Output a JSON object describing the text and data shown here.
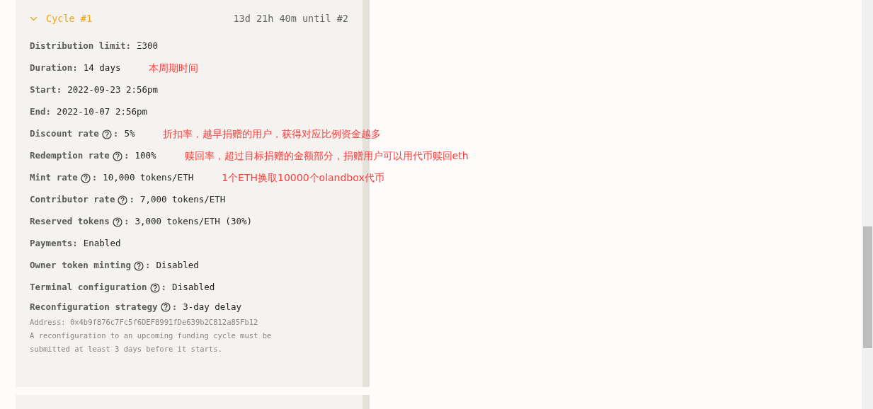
{
  "separator": ":",
  "cycle": {
    "title": "Cycle #1",
    "expanded": true,
    "countdown": "13d 21h 40m until #2"
  },
  "details": [
    {
      "label": "Distribution limit",
      "help": false,
      "value": "Ξ300"
    },
    {
      "label": "Duration",
      "help": false,
      "value": "14 days",
      "annotation": "本周期时间"
    },
    {
      "label": "Start",
      "help": false,
      "value": "2022-09-23 2:56pm"
    },
    {
      "label": "End",
      "help": false,
      "value": "2022-10-07 2:56pm"
    },
    {
      "label": "Discount rate",
      "help": true,
      "value": "5%",
      "annotation": "折扣率，越早捐赠的用户，获得对应比例资金越多"
    },
    {
      "label": "Redemption rate",
      "help": true,
      "value": "100%",
      "annotation": "赎回率，超过目标捐赠的金额部分，捐赠用户可以用代币赎回eth"
    },
    {
      "label": "Mint rate",
      "help": true,
      "value": "10,000 tokens/ETH",
      "annotation": "1个ETH换取10000个olandbox代币"
    },
    {
      "label": "Contributor rate",
      "help": true,
      "value": "7,000 tokens/ETH"
    },
    {
      "label": "Reserved tokens",
      "help": true,
      "value": "3,000 tokens/ETH (30%)"
    },
    {
      "label": "Payments",
      "help": false,
      "value": "Enabled"
    },
    {
      "label": "Owner token minting",
      "help": true,
      "value": "Disabled"
    },
    {
      "label": "Terminal configuration",
      "help": true,
      "value": "Disabled"
    }
  ],
  "reconfiguration": {
    "label": "Reconfiguration strategy",
    "help": true,
    "value": "3-day delay",
    "address": "Address: 0x4b9f876c7Fc5f6DEF8991fDe639b2C812a85Fb12",
    "note": "A reconfiguration to an upcoming funding cycle must be submitted at least 3 days before it starts."
  }
}
